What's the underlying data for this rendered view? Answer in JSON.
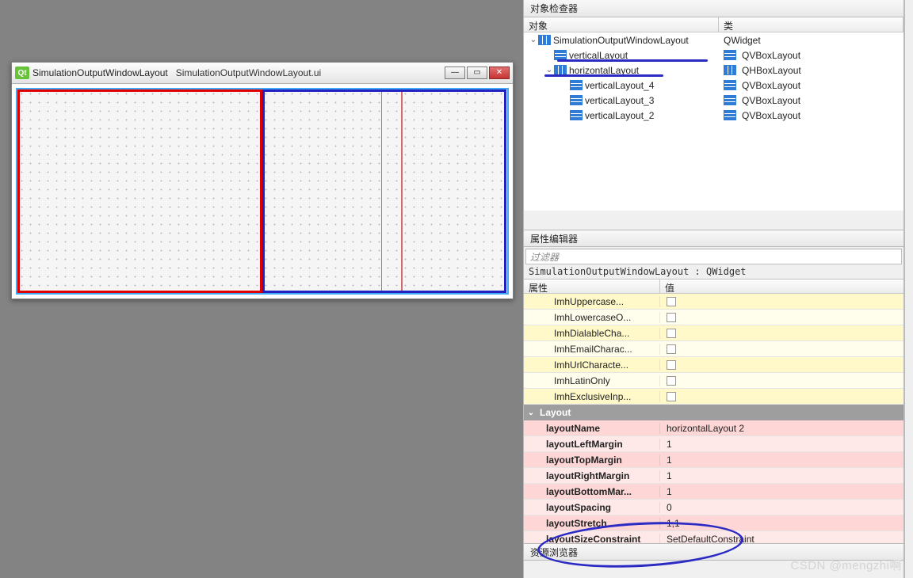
{
  "inspector": {
    "title": "对象检查器",
    "columns": {
      "obj": "对象",
      "cls": "类"
    },
    "rows": [
      {
        "indent": 0,
        "expander": "v",
        "icon": "hbox",
        "name": "SimulationOutputWindowLayout",
        "clsIcon": "",
        "cls": "QWidget"
      },
      {
        "indent": 1,
        "expander": "",
        "icon": "vbox",
        "name": "verticalLayout",
        "clsIcon": "vbox",
        "cls": "QVBoxLayout"
      },
      {
        "indent": 1,
        "expander": "v",
        "icon": "hbox",
        "name": "horizontalLayout",
        "clsIcon": "hbox",
        "cls": "QHBoxLayout"
      },
      {
        "indent": 2,
        "expander": "",
        "icon": "vbox",
        "name": "verticalLayout_4",
        "clsIcon": "vbox",
        "cls": "QVBoxLayout"
      },
      {
        "indent": 2,
        "expander": "",
        "icon": "vbox",
        "name": "verticalLayout_3",
        "clsIcon": "vbox",
        "cls": "QVBoxLayout"
      },
      {
        "indent": 2,
        "expander": "",
        "icon": "vbox",
        "name": "verticalLayout_2",
        "clsIcon": "vbox",
        "cls": "QVBoxLayout"
      }
    ]
  },
  "propertyEditor": {
    "title": "属性编辑器",
    "filterPlaceholder": "过滤器",
    "contextLine": "SimulationOutputWindowLayout : QWidget",
    "columns": {
      "prop": "属性",
      "val": "值"
    },
    "yellowRows": [
      {
        "k": "ImhUppercase...",
        "checkbox": true
      },
      {
        "k": "ImhLowercaseO...",
        "checkbox": true
      },
      {
        "k": "ImhDialableCha...",
        "checkbox": true
      },
      {
        "k": "ImhEmailCharac...",
        "checkbox": true
      },
      {
        "k": "ImhUrlCharacte...",
        "checkbox": true
      },
      {
        "k": "ImhLatinOnly",
        "checkbox": true
      },
      {
        "k": "ImhExclusiveInp...",
        "checkbox": true
      }
    ],
    "groupLabel": "Layout",
    "pinkRows": [
      {
        "k": "layoutName",
        "v": "horizontalLayout 2"
      },
      {
        "k": "layoutLeftMargin",
        "v": "1"
      },
      {
        "k": "layoutTopMargin",
        "v": "1"
      },
      {
        "k": "layoutRightMargin",
        "v": "1"
      },
      {
        "k": "layoutBottomMar...",
        "v": "1"
      },
      {
        "k": "layoutSpacing",
        "v": "0"
      },
      {
        "k": "layoutStretch",
        "v": "1,1"
      },
      {
        "k": "layoutSizeConstraint",
        "v": "SetDefaultConstraint"
      }
    ]
  },
  "resourceBrowser": {
    "title": "资源浏览器"
  },
  "dialog": {
    "title": "SimulationOutputWindowLayout",
    "subtitle": "SimulationOutputWindowLayout.ui",
    "qtBadge": "Qt",
    "min": "—",
    "max": "▭",
    "close": "✕"
  },
  "watermark": "CSDN @mengzhi啊"
}
